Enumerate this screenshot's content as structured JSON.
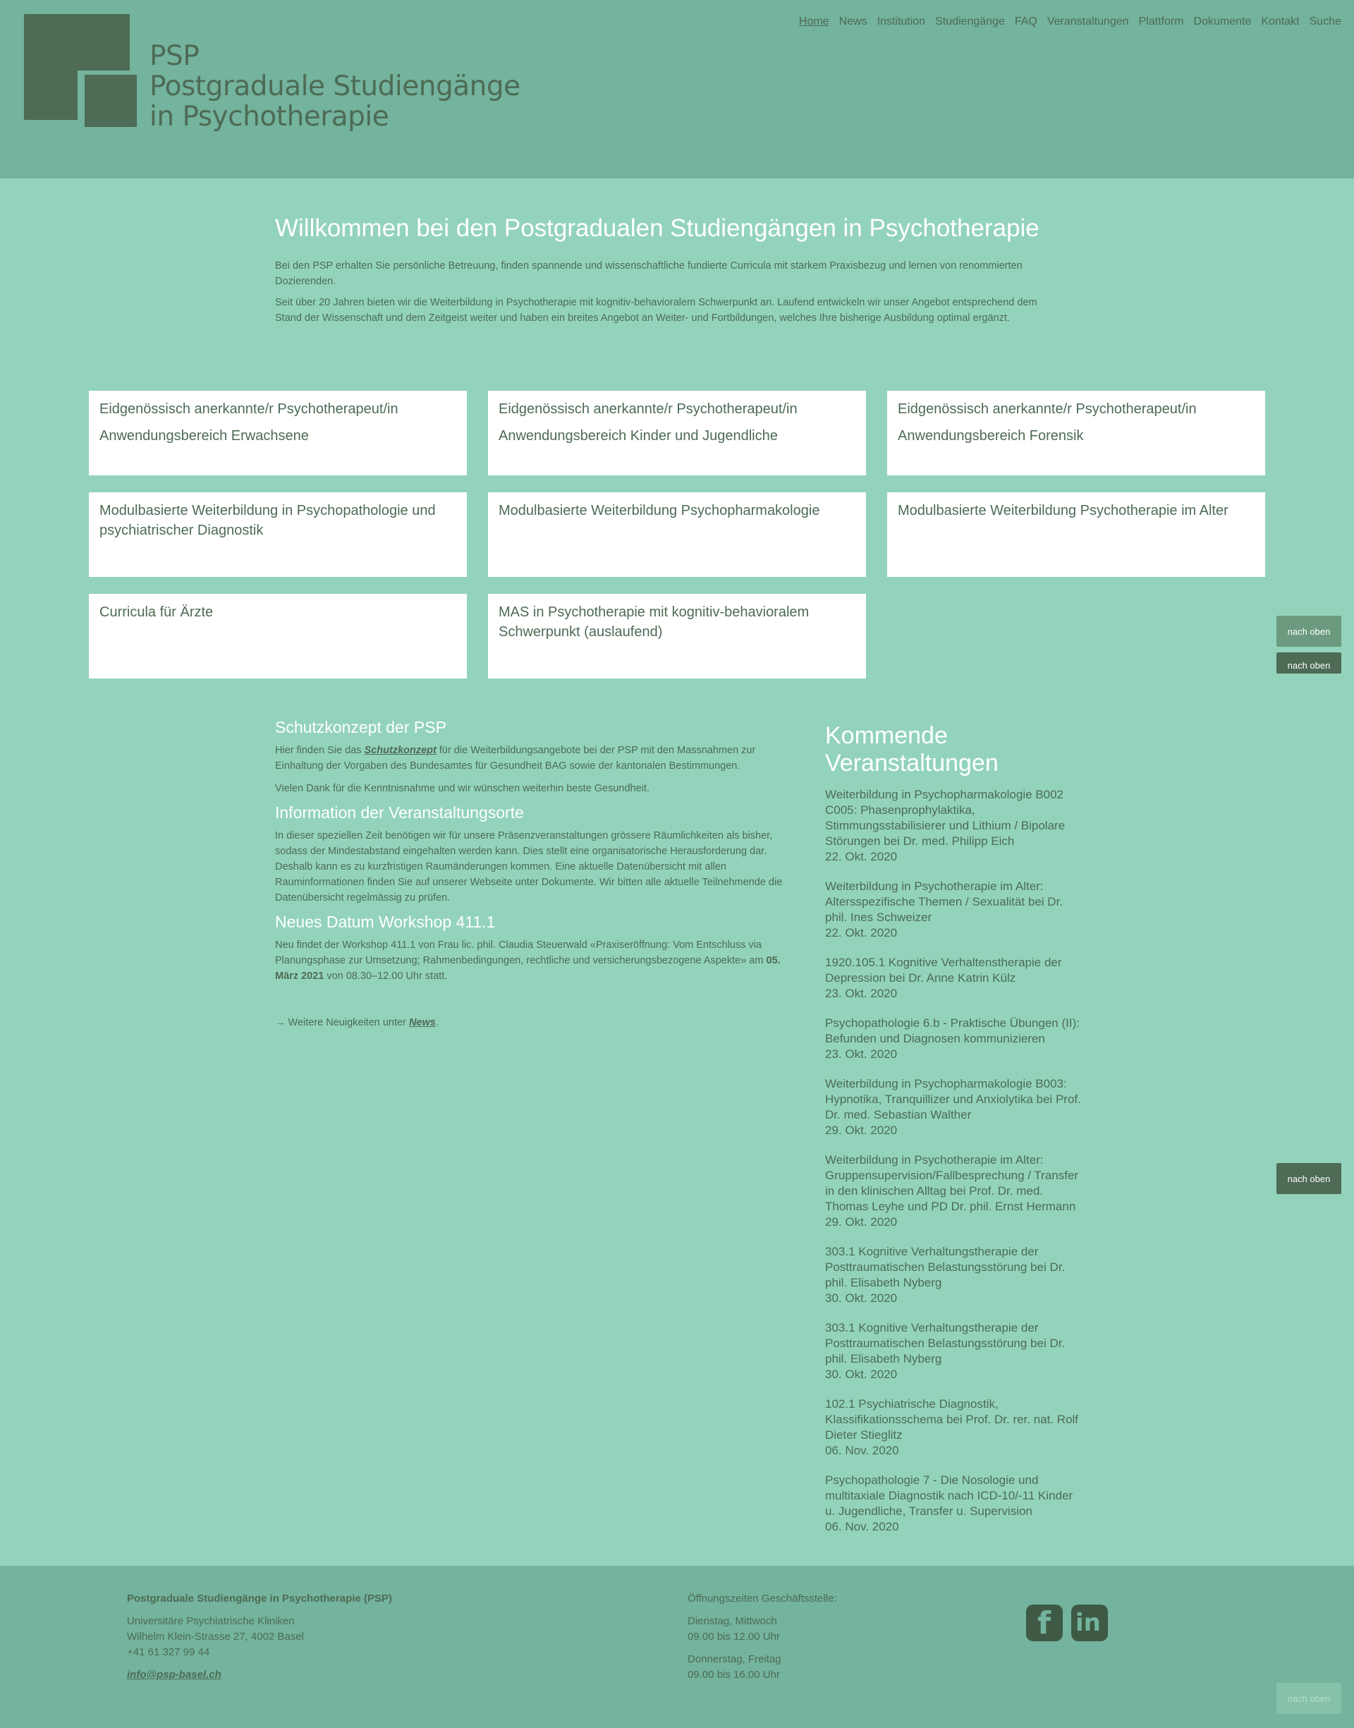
{
  "header": {
    "logo_line1": "PSP",
    "logo_line2": "Postgraduale Studiengänge",
    "logo_line3": "in Psychotherapie",
    "nav": [
      "Home",
      "News",
      "Institution",
      "Studiengänge",
      "FAQ",
      "Veranstaltungen",
      "Plattform",
      "Dokumente",
      "Kontakt",
      "Suche"
    ]
  },
  "intro": {
    "title": "Willkommen bei den Postgradualen Studiengängen in Psychotherapie",
    "p1": "Bei den PSP erhalten Sie persönliche Betreuung, finden spannende und wissenschaftliche fundierte Curricula mit starkem Praxisbezug und lernen von renommierten Dozierenden.",
    "p2": "Seit über 20 Jahren bieten wir die Weiterbildung in Psychotherapie mit kognitiv-behavioralem Schwerpunkt an. Laufend entwickeln wir unser Angebot entsprechend dem Stand der Wissenschaft und dem Zeitgeist weiter und haben ein breites Angebot an Weiter- und Fortbildungen, welches Ihre bisherige Ausbildung optimal ergänzt."
  },
  "cards": [
    {
      "title": "Eidgenössisch anerkannte/r Psychotherapeut/in",
      "sub": "Anwendungsbereich Erwachsene"
    },
    {
      "title": "Eidgenössisch anerkannte/r Psychotherapeut/in",
      "sub": "Anwendungsbereich Kinder und Jugendliche"
    },
    {
      "title": "Eidgenössisch anerkannte/r Psychotherapeut/in",
      "sub": "Anwendungsbereich Forensik"
    },
    {
      "title": "Modulbasierte Weiterbildung in Psychopathologie und psychiatrischer Diagnostik",
      "sub": ""
    },
    {
      "title": "Modulbasierte Weiterbildung Psychopharmakologie",
      "sub": ""
    },
    {
      "title": "Modulbasierte Weiterbildung Psychotherapie im Alter",
      "sub": ""
    },
    {
      "title": "Curricula für Ärzte",
      "sub": ""
    },
    {
      "title": "MAS in Psychotherapie mit kognitiv-behavioralem Schwerpunkt (auslaufend)",
      "sub": ""
    }
  ],
  "news": {
    "h1": "Schutzkonzept der PSP",
    "p1_before": "Hier finden Sie das ",
    "p1_link": "Schutzkonzept",
    "p1_after": " für die Weiterbildungsangebote bei der PSP mit den Massnahmen zur Einhaltung der Vorgaben des Bundesamtes für Gesundheit BAG sowie der kantonalen Bestimmungen.",
    "p2": "Vielen Dank für die Kenntnisnahme und wir wünschen weiterhin beste Gesundheit.",
    "h2": "Information der Veranstaltungsorte",
    "p3": "In dieser speziellen Zeit benötigen wir für unsere Präsenzveranstaltungen grössere Räumlichkeiten als bisher, sodass der Mindestabstand eingehalten werden kann. Dies stellt eine organisatorische Herausforderung dar. Deshalb kann es zu kurzfristigen Raumänderungen kommen. Eine aktuelle Datenübersicht mit allen Rauminformationen finden Sie auf unserer Webseite unter Dokumente. Wir bitten alle aktuelle Teilnehmende die Datenübersicht regelmässig zu prüfen.",
    "h3": "Neues Datum Workshop 411.1",
    "p4_before": "Neu findet der Workshop 411.1 von Frau lic. phil. Claudia Steuerwald «Praxiseröffnung: Vom Entschluss via Planungsphase zur Umsetzung; Rahmenbedingungen, rechtliche und versicherungsbezogene Aspekte» am ",
    "p4_bold": "05. März 2021",
    "p4_after": " von 08.30–12.00 Uhr statt.",
    "more_before": "→ Weitere Neuigkeiten unter ",
    "more_link": "News",
    "more_after": "."
  },
  "events": {
    "title": "Kommende Veranstaltungen",
    "items": [
      {
        "text": "Weiterbildung in Psychopharmakologie B002 C005: Phasenprophylaktika, Stimmungsstabilisierer und Lithium / Bipolare Störungen bei Dr. med. Philipp Eich",
        "date": "22. Okt. 2020"
      },
      {
        "text": "Weiterbildung in Psychotherapie im Alter: Altersspezifische Themen / Sexualität bei Dr. phil. Ines Schweizer",
        "date": "22. Okt. 2020"
      },
      {
        "text": "1920.105.1 Kognitive Verhaltenstherapie der Depression bei Dr. Anne Katrin Külz",
        "date": "23. Okt. 2020"
      },
      {
        "text": "Psychopathologie 6.b - Praktische Übungen (II): Befunden und Diagnosen kommunizieren",
        "date": "23. Okt. 2020"
      },
      {
        "text": "Weiterbildung in Psychopharmakologie B003: Hypnotika, Tranquillizer und Anxiolytika bei Prof. Dr. med. Sebastian Walther",
        "date": "29. Okt. 2020"
      },
      {
        "text": "Weiterbildung in Psychotherapie im Alter: Gruppensupervision/Fallbesprechung / Transfer in den klinischen Alltag bei Prof. Dr. med. Thomas Leyhe und PD Dr. phil. Ernst Hermann",
        "date": "29. Okt. 2020"
      },
      {
        "text": "303.1 Kognitive Verhaltungstherapie der Posttraumatischen Belastungsstörung bei Dr. phil. Elisabeth Nyberg",
        "date": "30. Okt. 2020"
      },
      {
        "text": "303.1 Kognitive Verhaltungstherapie der Posttraumatischen Belastungsstörung bei Dr. phil. Elisabeth Nyberg",
        "date": "30. Okt. 2020"
      },
      {
        "text": "102.1 Psychiatrische Diagnostik, Klassifikationsschema bei Prof. Dr. rer. nat. Rolf Dieter Stieglitz",
        "date": "06. Nov. 2020"
      },
      {
        "text": "Psychopathologie 7 - Die Nosologie und multitaxiale Diagnostik nach ICD-10/-11 Kinder u. Jugendliche, Transfer u. Supervision",
        "date": "06. Nov. 2020"
      }
    ]
  },
  "top_button": "nach oben",
  "footer": {
    "org": "Postgraduale Studiengänge in Psychotherapie (PSP)",
    "addr1": "Universitäre Psychiatrische Kliniken",
    "addr2": "Wilhelm Klein-Strasse 27, 4002 Basel",
    "phone": "+41 61 327 99 44",
    "email": "info@psp-basel.ch",
    "hours_title": "Öffnungszeiten Geschäftsstelle:",
    "days1": "Dienstag, Mittwoch",
    "time1": "09.00 bis 12.00 Uhr",
    "days2": "Donnerstag, Freitag",
    "time2": "09.00 bis 16.00 Uhr"
  },
  "colors": {
    "bg": "#93d3bb",
    "header": "#74b39d",
    "dark": "#4d6b55"
  }
}
